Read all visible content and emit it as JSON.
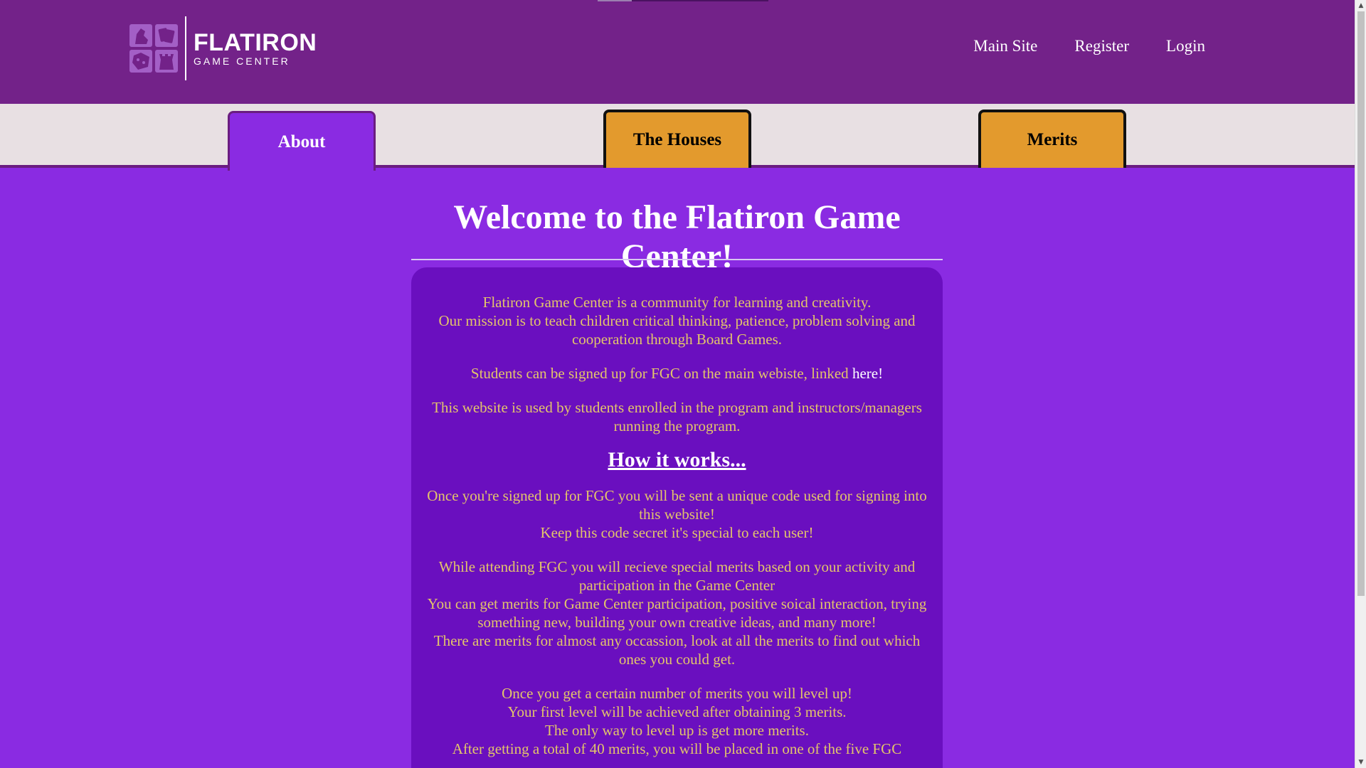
{
  "header": {
    "logo": {
      "name": "FLATIRON",
      "sub": "GAME CENTER"
    },
    "nav": [
      "Main Site",
      "Register",
      "Login"
    ]
  },
  "tabs": {
    "about": "About",
    "houses": "The Houses",
    "merits": "Merits"
  },
  "main": {
    "title": "Welcome to the Flatiron Game Center!",
    "intro_1": "Flatiron Game Center is a community for learning and creativity.",
    "intro_2": "Our mission is to teach children critical thinking, patience, problem solving and cooperation through Board Games.",
    "signup_text": "Students can be signed up for FGC on the main webiste, linked ",
    "signup_link": "here!",
    "usage": "This website is used by students enrolled in the program and instructors/managers running the program.",
    "how_heading": "How it works...",
    "code_1": "Once you're signed up for FGC you will be sent a unique code used for signing into this website!",
    "code_2": "Keep this code secret it's special to each user!",
    "merits_1": "While attending FGC you will recieve special merits based on your activity and participation in the Game Center",
    "merits_2": "You can get merits for Game Center participation, positive soical interaction, trying something new, building your own creative ideas, and many more!",
    "merits_3": "There are merits for almost any occassion, look at all the merits to find out which ones you could get.",
    "level_1": "Once you get a certain number of merits you will level up!",
    "level_2": "Your first level will be achieved after obtaining 3 merits.",
    "level_3": "The only way to level up is get more merits.",
    "level_4": "After getting a total of 40 merits, you will be placed in one of the five FGC"
  },
  "colors": {
    "background": "#8a2be2",
    "header": "#732289",
    "tab_inactive": "#e39a2d",
    "card": "#6a0fbf",
    "card_text": "#e3c56a"
  }
}
